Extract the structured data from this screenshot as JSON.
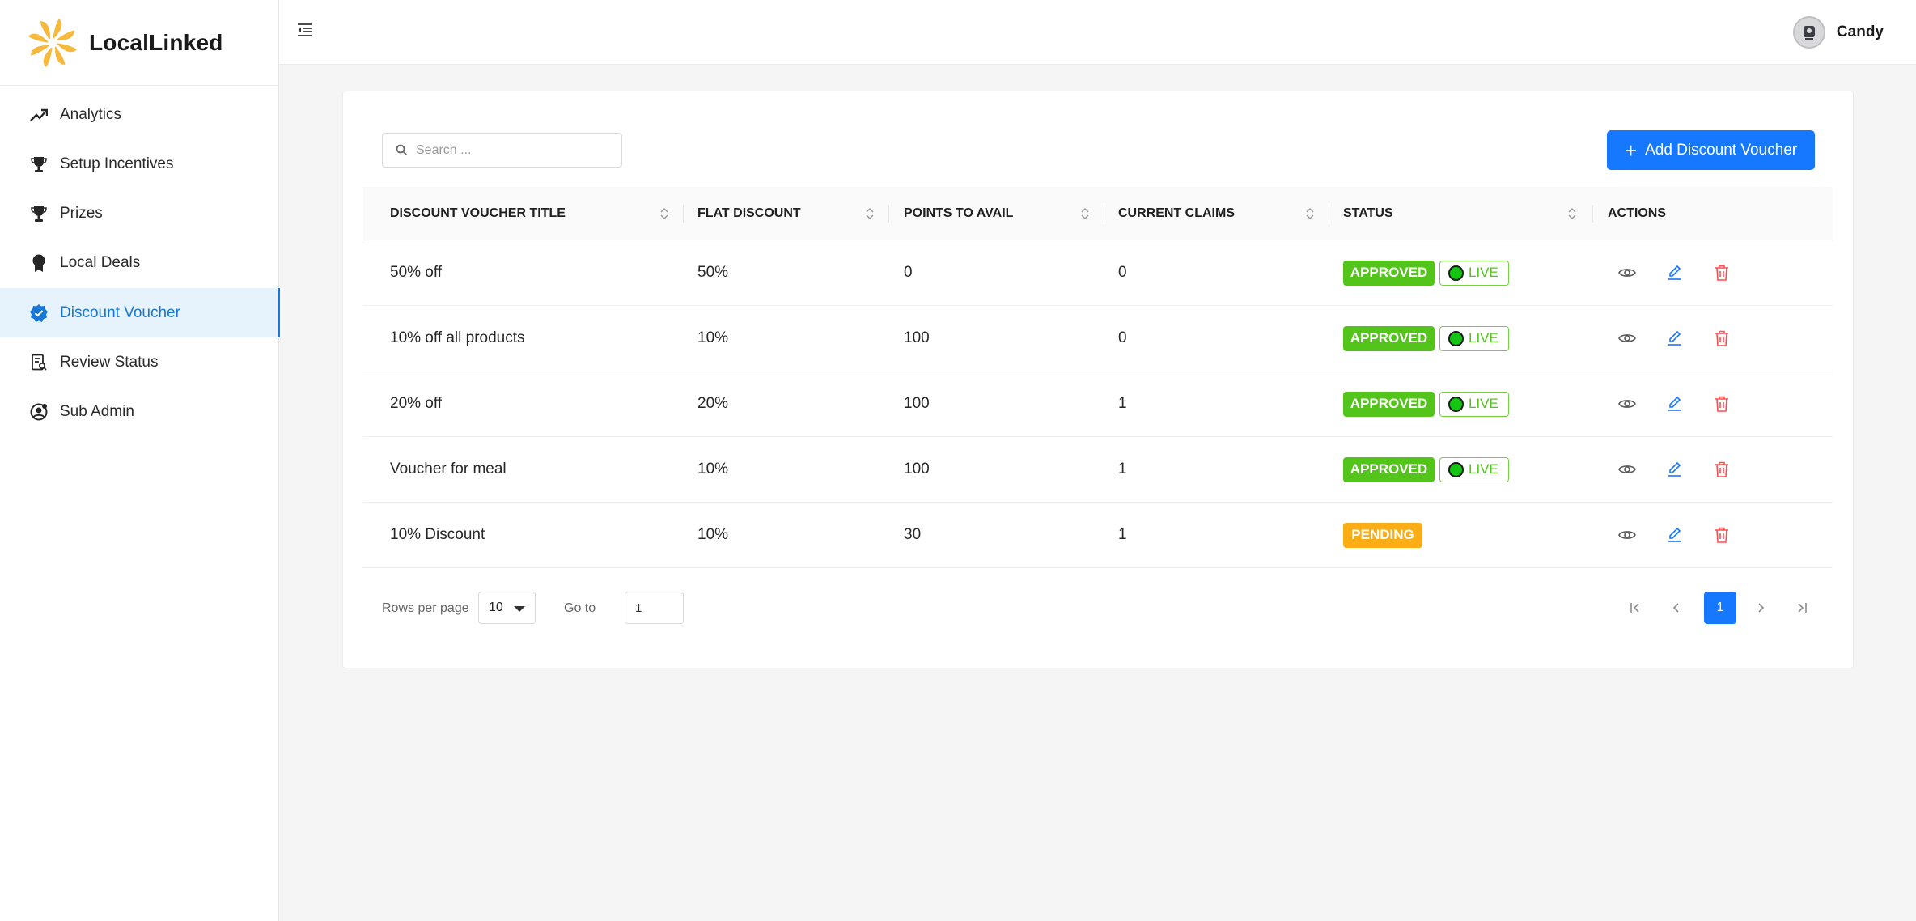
{
  "brand": {
    "name": "LocalLinked"
  },
  "sidebar": {
    "items": [
      {
        "label": "Analytics",
        "icon": "trending-up-icon"
      },
      {
        "label": "Setup Incentives",
        "icon": "trophy-icon"
      },
      {
        "label": "Prizes",
        "icon": "trophy-icon"
      },
      {
        "label": "Local Deals",
        "icon": "award-icon"
      },
      {
        "label": "Discount Voucher",
        "icon": "verified-badge-icon",
        "active": true
      },
      {
        "label": "Review Status",
        "icon": "review-document-icon"
      },
      {
        "label": "Sub Admin",
        "icon": "user-circle-icon"
      }
    ]
  },
  "header": {
    "user_name": "Candy"
  },
  "toolbar": {
    "search_placeholder": "Search ...",
    "add_label": "Add Discount Voucher"
  },
  "table": {
    "columns": [
      "DISCOUNT VOUCHER TITLE",
      "FLAT DISCOUNT",
      "POINTS TO AVAIL",
      "CURRENT CLAIMS",
      "STATUS",
      "ACTIONS"
    ],
    "rows": [
      {
        "title": "50% off",
        "discount": "50%",
        "points": "0",
        "claims": "0",
        "status": "APPROVED",
        "live": "LIVE"
      },
      {
        "title": "10% off all products",
        "discount": "10%",
        "points": "100",
        "claims": "0",
        "status": "APPROVED",
        "live": "LIVE"
      },
      {
        "title": "20% off",
        "discount": "20%",
        "points": "100",
        "claims": "1",
        "status": "APPROVED",
        "live": "LIVE"
      },
      {
        "title": "Voucher for meal",
        "discount": "10%",
        "points": "100",
        "claims": "1",
        "status": "APPROVED",
        "live": "LIVE"
      },
      {
        "title": "10% Discount",
        "discount": "10%",
        "points": "30",
        "claims": "1",
        "status": "PENDING",
        "live": ""
      }
    ]
  },
  "pagination": {
    "rows_per_page_label": "Rows per page",
    "rows_per_page_value": "10",
    "goto_label": "Go to",
    "goto_value": "1",
    "current_page": "1"
  },
  "colors": {
    "primary": "#1677ff",
    "approved": "#52c41a",
    "pending": "#faad14",
    "delete": "#ff4d4f",
    "active_nav_bg": "#e6f3fd"
  }
}
